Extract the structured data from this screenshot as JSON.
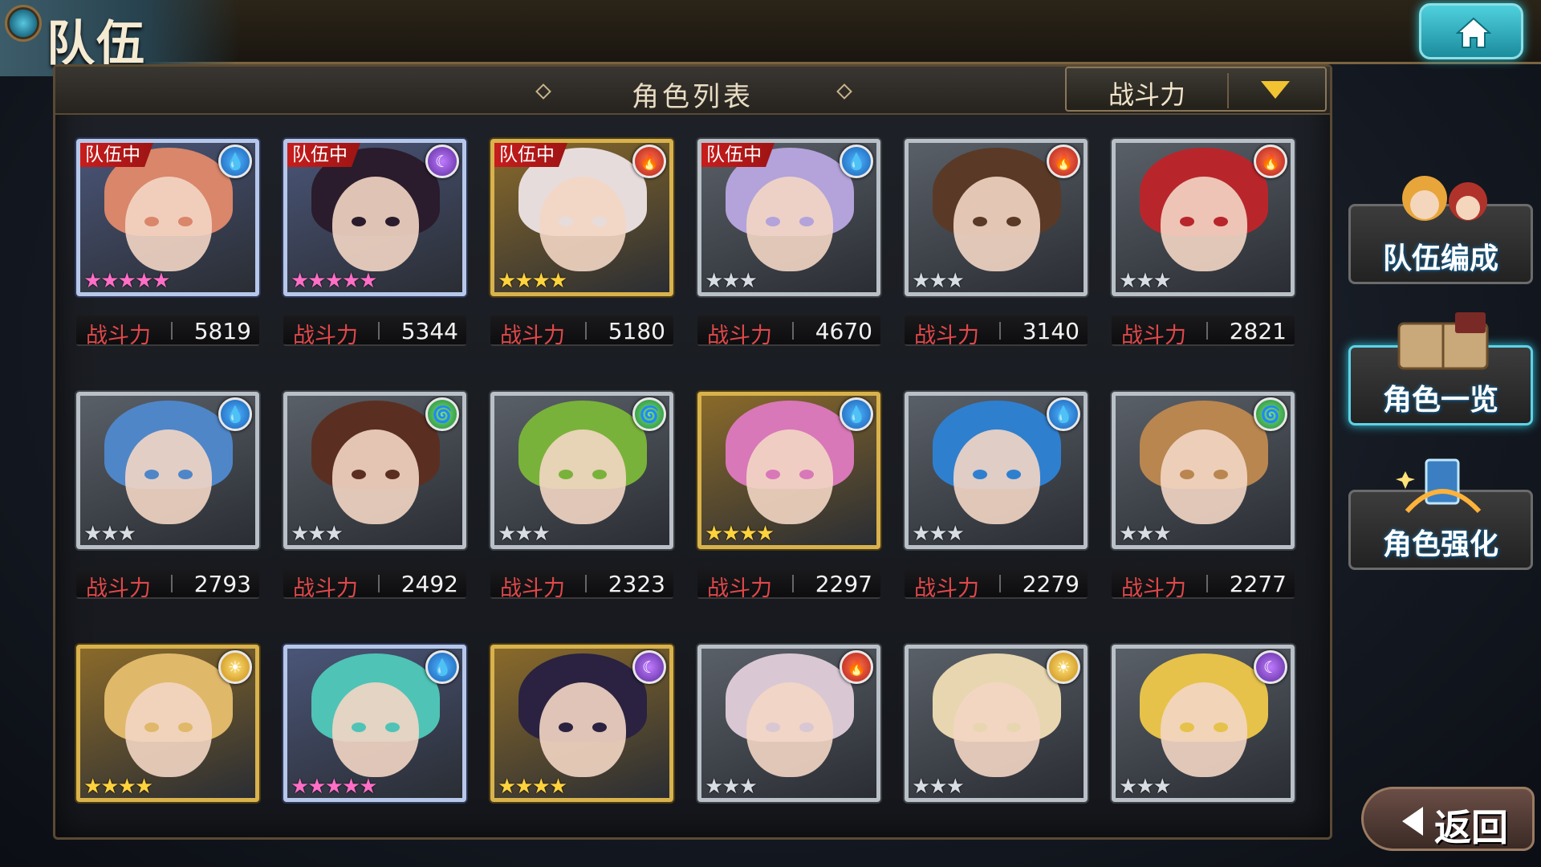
{
  "header": {
    "title": "队伍",
    "home_icon": "home-icon"
  },
  "panel": {
    "title": "角色列表",
    "sort_label": "战斗力",
    "sort_icon": "chevron-down-icon"
  },
  "power_label": "战斗力",
  "team_badge": "队伍中",
  "element_colors": {
    "water": "#1a5fb3",
    "dark": "#5b2b9c",
    "fire": "#b31c1c",
    "wind": "#1f8a36",
    "light": "#c88a10"
  },
  "characters": [
    {
      "in_team": true,
      "element": "water",
      "frame": "rainbow",
      "stars": "★★★★★",
      "power": "5819",
      "hair": "#d9866a"
    },
    {
      "in_team": true,
      "element": "dark",
      "frame": "rainbow",
      "stars": "★★★★★",
      "power": "5344",
      "hair": "#2a1c2c"
    },
    {
      "in_team": true,
      "element": "fire",
      "frame": "gold",
      "stars": "★★★★",
      "power": "5180",
      "hair": "#e6dcdc"
    },
    {
      "in_team": true,
      "element": "water",
      "frame": "silver",
      "stars": "★★★",
      "power": "4670",
      "hair": "#b3a3da"
    },
    {
      "in_team": false,
      "element": "fire",
      "frame": "silver",
      "stars": "★★★",
      "power": "3140",
      "hair": "#5a3a26"
    },
    {
      "in_team": false,
      "element": "fire",
      "frame": "silver",
      "stars": "★★★",
      "power": "2821",
      "hair": "#b8262c"
    },
    {
      "in_team": false,
      "element": "water",
      "frame": "silver",
      "stars": "★★★",
      "power": "2793",
      "hair": "#4f86c8"
    },
    {
      "in_team": false,
      "element": "wind",
      "frame": "silver",
      "stars": "★★★",
      "power": "2492",
      "hair": "#5a2f22"
    },
    {
      "in_team": false,
      "element": "wind",
      "frame": "silver",
      "stars": "★★★",
      "power": "2323",
      "hair": "#79b23a"
    },
    {
      "in_team": false,
      "element": "water",
      "frame": "gold",
      "stars": "★★★★",
      "power": "2297",
      "hair": "#d878b8"
    },
    {
      "in_team": false,
      "element": "water",
      "frame": "silver",
      "stars": "★★★",
      "power": "2279",
      "hair": "#2f7fcf"
    },
    {
      "in_team": false,
      "element": "wind",
      "frame": "silver",
      "stars": "★★★",
      "power": "2277",
      "hair": "#b98650"
    },
    {
      "in_team": false,
      "element": "light",
      "frame": "gold",
      "stars": "★★★★",
      "power": "",
      "hair": "#e0b86a"
    },
    {
      "in_team": false,
      "element": "water",
      "frame": "rainbow",
      "stars": "★★★★★",
      "power": "",
      "hair": "#4fc3b6"
    },
    {
      "in_team": false,
      "element": "dark",
      "frame": "gold",
      "stars": "★★★★",
      "power": "",
      "hair": "#2a2240"
    },
    {
      "in_team": false,
      "element": "fire",
      "frame": "silver",
      "stars": "★★★",
      "power": "",
      "hair": "#d9c8d4"
    },
    {
      "in_team": false,
      "element": "light",
      "frame": "silver",
      "stars": "★★★",
      "power": "",
      "hair": "#e8d6b0"
    },
    {
      "in_team": false,
      "element": "dark",
      "frame": "silver",
      "stars": "★★★",
      "power": "",
      "hair": "#e6c24a"
    }
  ],
  "side_menu": {
    "team_edit": "队伍编成",
    "character_list": "角色一览",
    "character_enhance": "角色强化"
  },
  "back_label": "返回"
}
